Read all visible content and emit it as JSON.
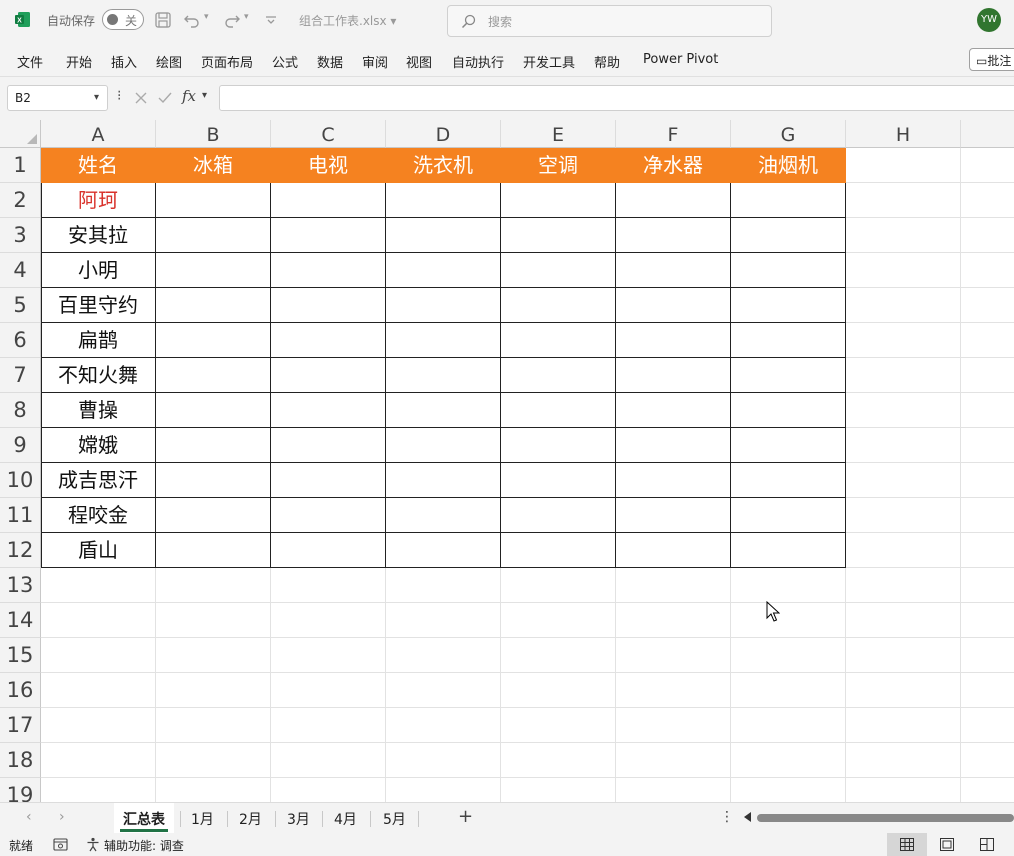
{
  "titlebar": {
    "autosave_label": "自动保存",
    "toggle_state": "关",
    "filename": "组合工作表.xlsx",
    "search_placeholder": "搜索",
    "avatar_initials": "YW"
  },
  "menu": {
    "items": [
      "文件",
      "开始",
      "插入",
      "绘图",
      "页面布局",
      "公式",
      "数据",
      "审阅",
      "视图",
      "自动执行",
      "开发工具",
      "帮助",
      "Power Pivot"
    ],
    "comment_label": "批注"
  },
  "formula_bar": {
    "name_box": "B2",
    "fx_label": "fx",
    "formula": ""
  },
  "grid": {
    "columns": [
      "A",
      "B",
      "C",
      "D",
      "E",
      "F",
      "G",
      "H"
    ],
    "row_numbers": [
      "1",
      "2",
      "3",
      "4",
      "5",
      "6",
      "7",
      "8",
      "9",
      "10",
      "11",
      "12",
      "13",
      "14",
      "15",
      "16",
      "17",
      "18",
      "19"
    ],
    "header_row": [
      "姓名",
      "冰箱",
      "电视",
      "洗衣机",
      "空调",
      "净水器",
      "油烟机"
    ],
    "names": [
      "阿珂",
      "安其拉",
      "小明",
      "百里守约",
      "扁鹊",
      "不知火舞",
      "曹操",
      "嫦娥",
      "成吉思汗",
      "程咬金",
      "盾山"
    ],
    "header_fill": "#f58220",
    "highlight_name_color": "#d8322b"
  },
  "sheet_tabs": {
    "tabs": [
      "汇总表",
      "1月",
      "2月",
      "3月",
      "4月",
      "5月"
    ],
    "active": "汇总表",
    "add_label": "+"
  },
  "statusbar": {
    "ready": "就绪",
    "accessibility": "辅助功能: 调查"
  }
}
